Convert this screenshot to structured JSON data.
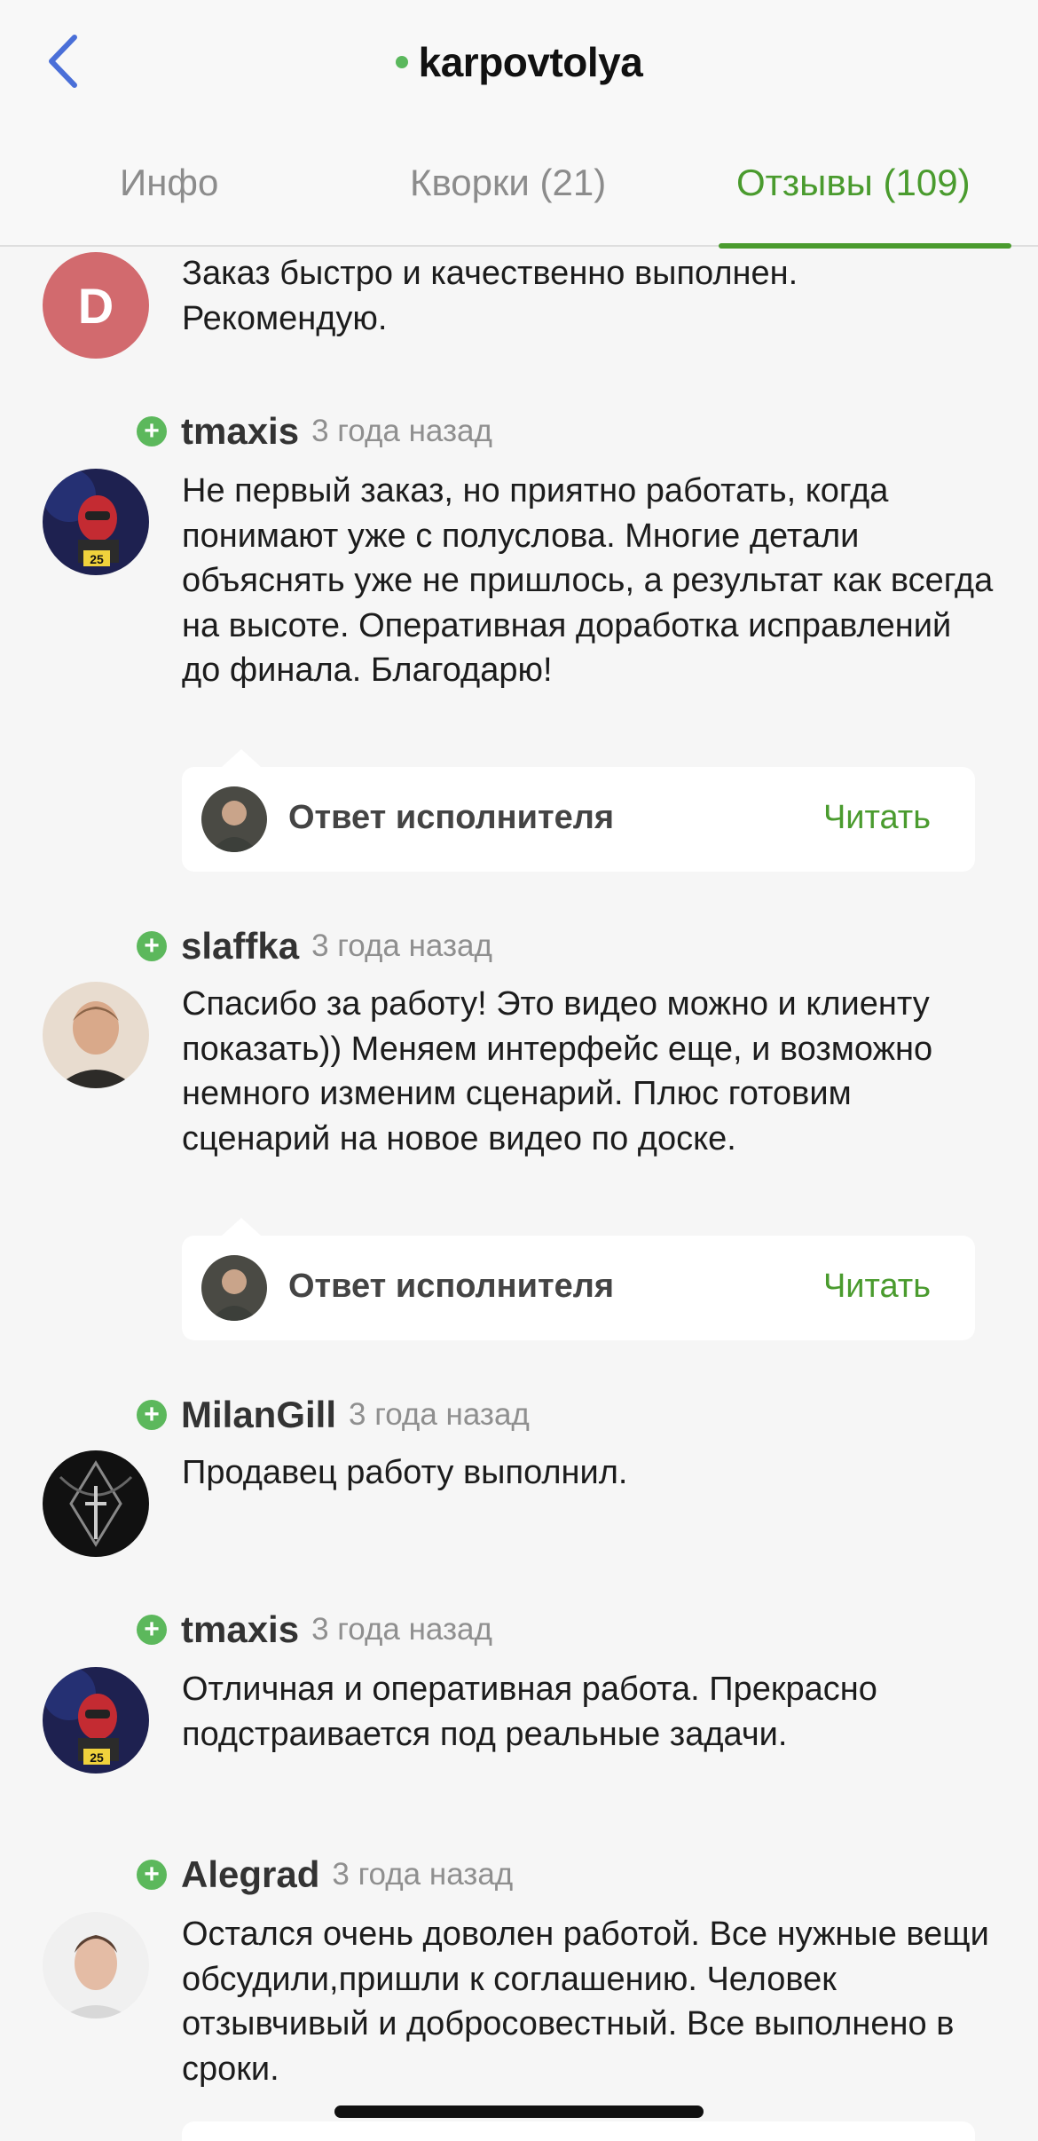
{
  "header": {
    "title": "karpovtolya",
    "online_color": "#5bb85d",
    "back_icon": "chevron-left-icon"
  },
  "tabs": [
    {
      "label": "Инфо",
      "active": false
    },
    {
      "label": "Кворки (21)",
      "active": false
    },
    {
      "label": "Отзывы (109)",
      "active": true
    }
  ],
  "accent_color": "#4a9b2e",
  "reviews": [
    {
      "avatar_letter": "D",
      "avatar_color": "#d26a6e",
      "text": "Заказ быстро и качественно выполнен. Рекомендую."
    },
    {
      "username": "tmaxis",
      "time": "3 года назад",
      "text": "Не первый заказ, но приятно работать, когда понимают уже с полуслова. Многие детали объяснять уже не пришлось, а результат как всегда на высоте. Оперативная доработка исправлений до финала. Благодарю!",
      "avatar_badge": "25",
      "reply": {
        "label": "Ответ исполнителя",
        "action": "Читать"
      }
    },
    {
      "username": "slaffka",
      "time": "3 года назад",
      "text": "Спасибо за работу! Это видео можно и клиенту показать)) Меняем интерфейс еще, и возможно немного изменим сценарий. Плюс готовим сценарий на новое видео по доске.",
      "reply": {
        "label": "Ответ исполнителя",
        "action": "Читать"
      }
    },
    {
      "username": "MilanGill",
      "time": "3 года назад",
      "text": "Продавец работу выполнил."
    },
    {
      "username": "tmaxis",
      "time": "3 года назад",
      "text": "Отличная и оперативная работа. Прекрасно подстраивается под реальные задачи.",
      "avatar_badge": "25"
    },
    {
      "username": "Alegrad",
      "time": "3 года назад",
      "text": "Остался очень доволен работой. Все нужные вещи обсудили,пришли к соглашению. Человек отзывчивый и добросовестный. Все выполнено в сроки."
    }
  ]
}
